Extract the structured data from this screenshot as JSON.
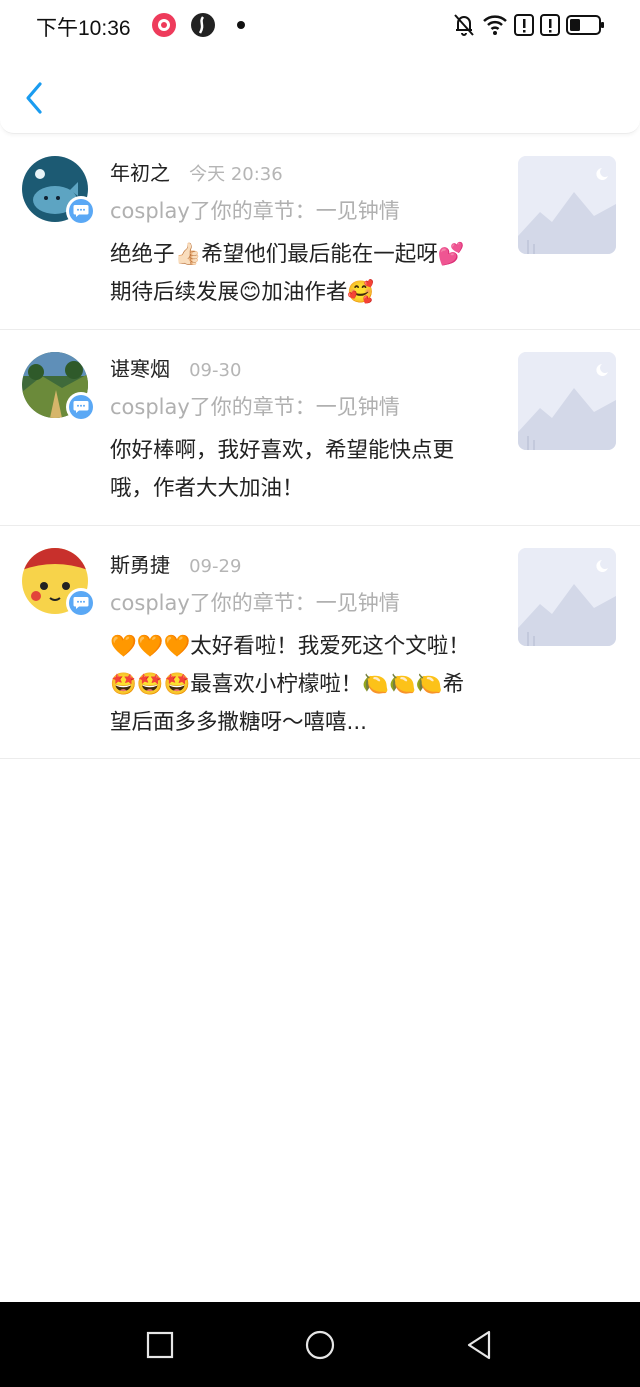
{
  "status_bar": {
    "time": "下午10:36",
    "icons": [
      "app-notification-icon",
      "app-globe-icon",
      "dot-icon",
      "mute-bell-icon",
      "wifi-icon",
      "alert-icon",
      "alert-icon",
      "battery-icon"
    ]
  },
  "header": {
    "back_icon": "chevron-left-icon",
    "accent_color": "#1a9cf0"
  },
  "notifications": [
    {
      "name": "年初之",
      "time": "今天 20:36",
      "action": "cosplay了你的章节：一见钟情",
      "comment": "绝绝子👍🏻希望他们最后能在一起呀💕期待后续发展😊加油作者🥰"
    },
    {
      "name": "谌寒烟",
      "time": "09-30",
      "action": "cosplay了你的章节：一见钟情",
      "comment": "你好棒啊，我好喜欢，希望能快点更哦，作者大大加油！"
    },
    {
      "name": "斯勇捷",
      "time": "09-29",
      "action": "cosplay了你的章节：一见钟情",
      "comment": "🧡🧡🧡太好看啦！我爱死这个文啦！🤩🤩🤩最喜欢小柠檬啦！🍋🍋🍋希望后面多多撒糖呀～嘻嘻..."
    }
  ],
  "nav_bar": {
    "icons": [
      "recent-apps-icon",
      "home-icon",
      "back-triangle-icon"
    ]
  }
}
